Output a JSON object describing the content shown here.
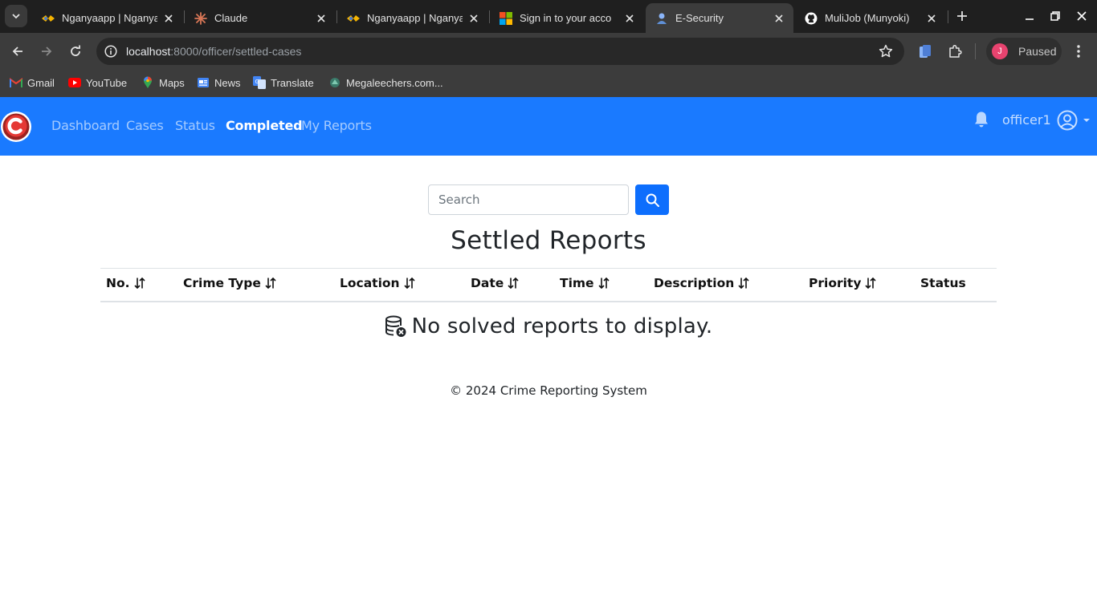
{
  "browser": {
    "tabs": [
      {
        "title": "Nganyaapp | Nganya",
        "favicon": "nganya-favicon"
      },
      {
        "title": "Claude",
        "favicon": "claude-favicon"
      },
      {
        "title": "Nganyaapp | Nganya",
        "favicon": "nganya-favicon"
      },
      {
        "title": "Sign in to your acco",
        "favicon": "microsoft-favicon"
      },
      {
        "title": "E-Security",
        "favicon": "e-security-favicon",
        "active": true
      },
      {
        "title": "MuliJob (Munyoki)",
        "favicon": "github-favicon"
      }
    ],
    "url": {
      "host": "localhost",
      "rest": ":8000/officer/settled-cases"
    },
    "profile": {
      "initial": "J",
      "status": "Paused"
    },
    "bookmarks": [
      {
        "label": "Gmail",
        "icon": "gmail-icon"
      },
      {
        "label": "YouTube",
        "icon": "youtube-icon"
      },
      {
        "label": "Maps",
        "icon": "maps-icon"
      },
      {
        "label": "News",
        "icon": "news-icon"
      },
      {
        "label": "Translate",
        "icon": "translate-icon"
      },
      {
        "label": "Megaleechers.com...",
        "icon": "megaleechers-icon"
      }
    ]
  },
  "navbar": {
    "brand_letter": "C",
    "links": {
      "dashboard": "Dashboard",
      "cases": "Cases",
      "status": "Status",
      "completed": "Completed",
      "my_reports": "My Reports"
    },
    "active": "Completed",
    "username": "officer1"
  },
  "search": {
    "placeholder": "Search"
  },
  "page": {
    "title": "Settled Reports"
  },
  "table": {
    "columns": [
      {
        "label": "No.",
        "sortable": true
      },
      {
        "label": "Crime Type",
        "sortable": true
      },
      {
        "label": "Location",
        "sortable": true
      },
      {
        "label": "Date",
        "sortable": true
      },
      {
        "label": "Time",
        "sortable": true
      },
      {
        "label": "Description",
        "sortable": true
      },
      {
        "label": "Priority",
        "sortable": true
      },
      {
        "label": "Status",
        "sortable": false
      }
    ],
    "rows": [],
    "empty_message": "No solved reports to display."
  },
  "footer": {
    "text": "© 2024 Crime Reporting System"
  },
  "colors": {
    "navbar": "#1a7aff",
    "primary_button": "#0d6efd",
    "brand_red": "#e53935"
  }
}
